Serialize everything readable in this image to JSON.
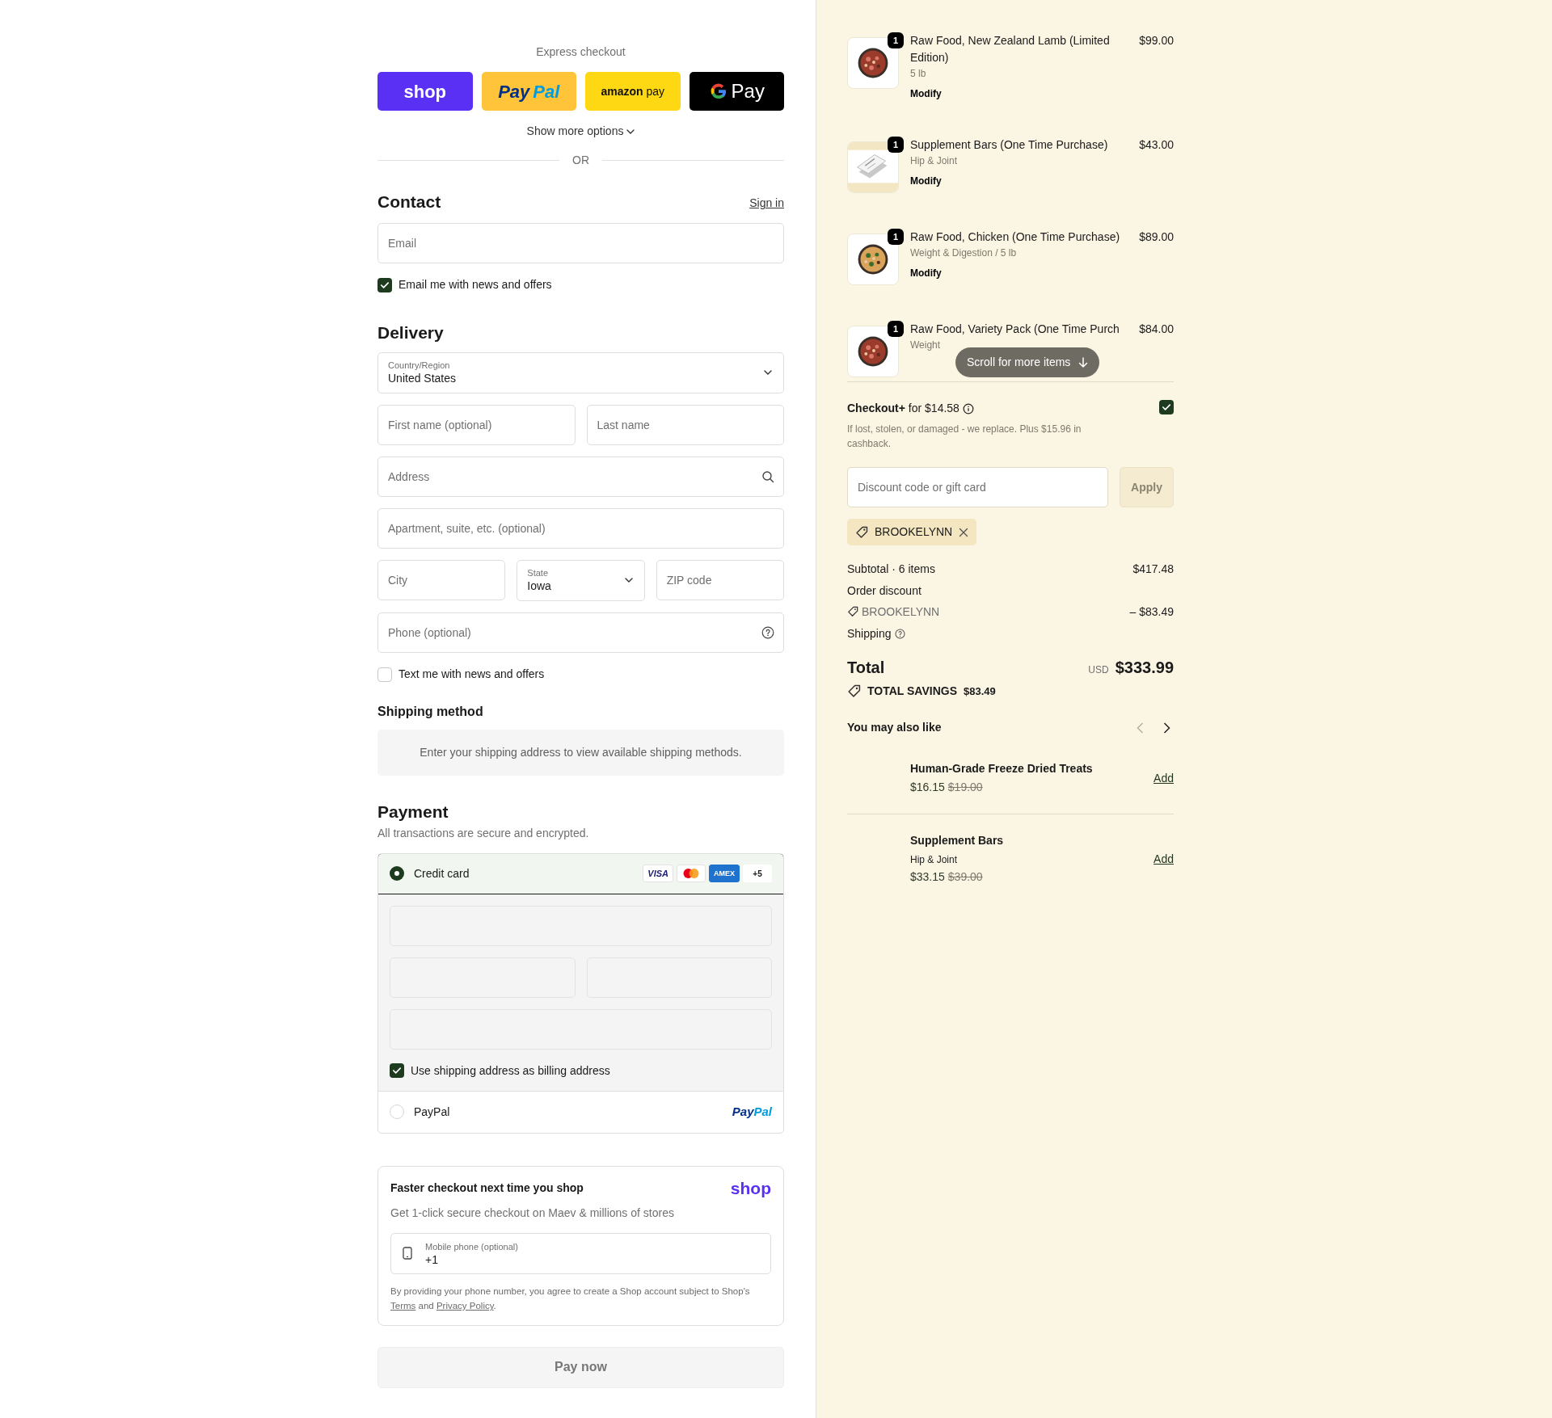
{
  "express_checkout": {
    "label": "Express checkout",
    "buttons": [
      {
        "kind": "shop",
        "label": "shop"
      },
      {
        "kind": "paypal",
        "label": "PayPal"
      },
      {
        "kind": "amazon",
        "label": "amazon pay"
      },
      {
        "kind": "gpay",
        "label": "Pay"
      }
    ],
    "more": "Show more options",
    "divider": "OR"
  },
  "contact": {
    "title": "Contact",
    "sign_in": "Sign in",
    "email": {
      "placeholder": "Email"
    },
    "newsletter": {
      "label": "Email me with news and offers",
      "checked": true
    }
  },
  "delivery": {
    "title": "Delivery",
    "rows": [
      [
        {
          "kind": "select",
          "label": "Country/Region",
          "value": "United States"
        }
      ],
      [
        {
          "kind": "text",
          "placeholder": "First name (optional)"
        },
        {
          "kind": "text",
          "placeholder": "Last name"
        }
      ],
      [
        {
          "kind": "search",
          "placeholder": "Address"
        }
      ],
      [
        {
          "kind": "text",
          "placeholder": "Apartment, suite, etc. (optional)"
        }
      ],
      [
        {
          "kind": "text",
          "placeholder": "City"
        },
        {
          "kind": "select",
          "label": "State",
          "value": "Iowa"
        },
        {
          "kind": "text",
          "placeholder": "ZIP code"
        }
      ],
      [
        {
          "kind": "help",
          "placeholder": "Phone (optional)"
        }
      ]
    ],
    "sms": {
      "label": "Text me with news and offers",
      "checked": false
    }
  },
  "shipping_method": {
    "title": "Shipping method",
    "message": "Enter your shipping address to view available shipping methods."
  },
  "payment": {
    "title": "Payment",
    "subtitle": "All transactions are secure and encrypted.",
    "methods": [
      {
        "kind": "card",
        "label": "Credit card",
        "selected": true,
        "brands": [
          {
            "kind": "visa",
            "label": "VISA"
          },
          {
            "kind": "mastercard"
          },
          {
            "kind": "amex",
            "label": "AMEX"
          }
        ],
        "more": "+5",
        "fields": [
          {
            "kind": "full"
          },
          {
            "kind": "half"
          },
          {
            "kind": "half"
          },
          {
            "kind": "full"
          }
        ],
        "billing": {
          "label": "Use shipping address as billing address",
          "checked": true
        }
      },
      {
        "kind": "paypal",
        "label": "PayPal",
        "selected": false,
        "logo": "PayPal"
      }
    ]
  },
  "shop_pay": {
    "title": "Faster checkout next time you shop",
    "logo": "shop",
    "subtitle": "Get 1-click secure checkout on Maev & millions of stores",
    "phone": {
      "label": "Mobile phone (optional)",
      "value": "+1"
    },
    "legal": {
      "text": "By providing your phone number, you agree to create a Shop account subject to Shop's",
      "terms": "Terms",
      "joiner": "and",
      "privacy": "Privacy Policy",
      "end": "."
    }
  },
  "pay_button": {
    "label": "Pay now",
    "disabled": true
  },
  "cart": {
    "items": [
      {
        "quantity": "1",
        "title": "Raw Food, New Zealand Lamb (Limited Edition)",
        "variant": "5 lb",
        "price": "$99.00",
        "modify": "Modify"
      },
      {
        "quantity": "1",
        "title": "Supplement Bars (One Time Purchase)",
        "variant": "Hip & Joint",
        "price": "$43.00",
        "modify": "Modify"
      },
      {
        "quantity": "1",
        "title": "Raw Food, Chicken (One Time Purchase)",
        "variant": "Weight & Digestion / 5 lb",
        "price": "$89.00",
        "modify": "Modify"
      },
      {
        "quantity": "1",
        "title": "Raw Food, Variety Pack (One Time Purch",
        "variant": "Weight",
        "price": "$84.00"
      }
    ],
    "scroll_hint": "Scroll for more items"
  },
  "checkout_plus": {
    "title": "**Checkout+** for $14.58",
    "description": "If lost, stolen, or damaged - we replace. Plus $15.96 in cashback.",
    "checked": true
  },
  "discount": {
    "placeholder": "Discount code or gift card",
    "apply": "Apply",
    "apply_disabled": true,
    "codes": [
      {
        "code": "BROOKELYNN"
      }
    ]
  },
  "summary": {
    "subtotal_label": "Subtotal · 6 items",
    "subtotal": "$417.48",
    "discount_label": "Order discount",
    "discount_code": "BROOKELYNN",
    "discount_amount": "– $83.49",
    "shipping_label": "Shipping",
    "total_label": "Total",
    "currency": "USD",
    "total": "$333.99",
    "savings_label": "TOTAL SAVINGS",
    "savings": "$83.49"
  },
  "recommendations": {
    "title": "You may also like",
    "prev_disabled": true,
    "next_disabled": false,
    "items": [
      {
        "title": "Human-Grade Freeze Dried Treats",
        "price": "$16.15",
        "compare_price": "$19.00",
        "add": "Add"
      },
      {
        "title": "Supplement Bars",
        "variant": "Hip & Joint",
        "price": "$33.15",
        "compare_price": "$39.00",
        "add": "Add"
      }
    ]
  }
}
